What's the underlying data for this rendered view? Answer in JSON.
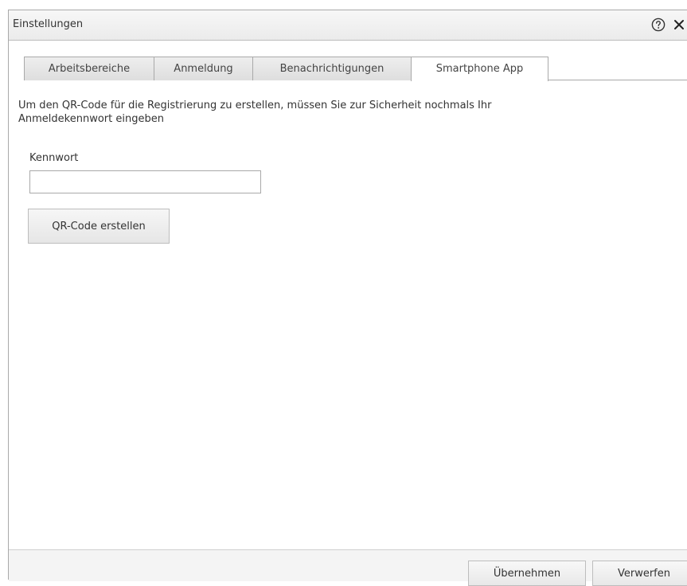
{
  "window": {
    "title": "Einstellungen",
    "help_icon": "help-circle-icon",
    "close_icon": "close-icon"
  },
  "tabs": [
    {
      "label": "Arbeitsbereiche",
      "active": false
    },
    {
      "label": "Anmeldung",
      "active": false
    },
    {
      "label": "Benachrichtigungen",
      "active": false
    },
    {
      "label": "Smartphone App",
      "active": true
    }
  ],
  "content": {
    "instruction_line1": "Um den QR-Code für die Registrierung zu erstellen, müssen Sie zur Sicherheit nochmals Ihr",
    "instruction_line2": "Anmeldekennwort eingeben",
    "password_label": "Kennwort",
    "password_value": "",
    "create_qr_label": "QR-Code erstellen"
  },
  "footer": {
    "apply_label": "Übernehmen",
    "discard_label": "Verwerfen"
  }
}
